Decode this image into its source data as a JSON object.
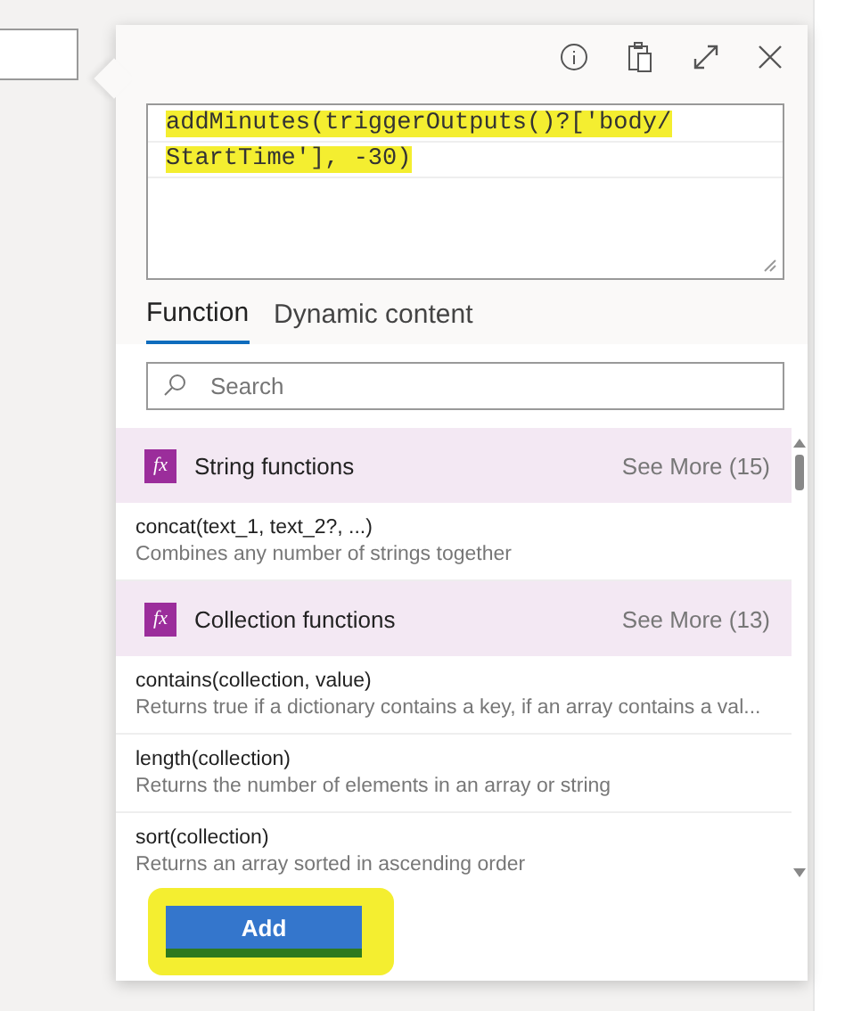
{
  "editor": {
    "lines": [
      "addMinutes(triggerOutputs()?['body/",
      "StartTime'], -30)"
    ],
    "highlighted": true
  },
  "tabs": [
    {
      "label": "Function",
      "selected": true
    },
    {
      "label": "Dynamic content",
      "selected": false
    }
  ],
  "search": {
    "placeholder": "Search"
  },
  "list": [
    {
      "kind": "category",
      "icon": "fx",
      "title": "String functions",
      "more": "See More (15)"
    },
    {
      "kind": "function",
      "signature": "concat(text_1, text_2?, ...)",
      "description": "Combines any number of strings together"
    },
    {
      "kind": "category",
      "icon": "fx",
      "title": "Collection functions",
      "more": "See More (13)"
    },
    {
      "kind": "function",
      "signature": "contains(collection, value)",
      "description": "Returns true if a dictionary contains a key, if an array contains a val..."
    },
    {
      "kind": "function",
      "signature": "length(collection)",
      "description": "Returns the number of elements in an array or string"
    },
    {
      "kind": "function",
      "signature": "sort(collection)",
      "description": "Returns an array sorted in ascending order"
    }
  ],
  "add_button": {
    "label": "Add",
    "highlighted": true
  }
}
